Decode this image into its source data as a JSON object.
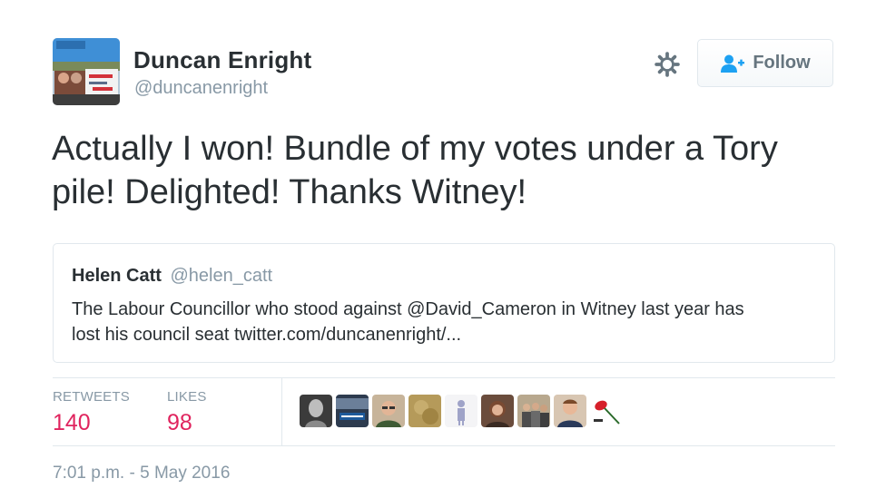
{
  "author": {
    "name": "Duncan Enright",
    "handle": "@duncanenright",
    "avatar_icon": "profile-photo-campaign"
  },
  "actions": {
    "gear_icon": "gear-icon",
    "follow_label": "Follow",
    "follow_icon": "add-user-icon"
  },
  "tweet": {
    "line1": "Actually I won! Bundle of my votes under a Tory",
    "line2": "pile! Delighted! Thanks Witney!"
  },
  "quote": {
    "name": "Helen Catt",
    "handle": "@helen_catt",
    "line1": "The Labour Councillor who stood against @David_Cameron in Witney last year has",
    "line2": "lost his council seat twitter.com/duncanenright/..."
  },
  "stats": {
    "retweets_label": "RETWEETS",
    "retweets_value": "140",
    "likes_label": "LIKES",
    "likes_value": "98"
  },
  "likers": [
    {
      "icon": "portrait-engraving-avatar"
    },
    {
      "icon": "banner-avatar"
    },
    {
      "icon": "man-glasses-avatar"
    },
    {
      "icon": "gold-texture-avatar"
    },
    {
      "icon": "figure-avatar"
    },
    {
      "icon": "woman-avatar"
    },
    {
      "icon": "group-avatar"
    },
    {
      "icon": "man-avatar"
    },
    {
      "icon": "red-rose-avatar"
    }
  ],
  "timestamp": "7:01 p.m. - 5 May 2016",
  "colors": {
    "accent_like": "#e0245e",
    "muted": "#8899a6",
    "text": "#292f33",
    "border": "#e1e8ed"
  }
}
